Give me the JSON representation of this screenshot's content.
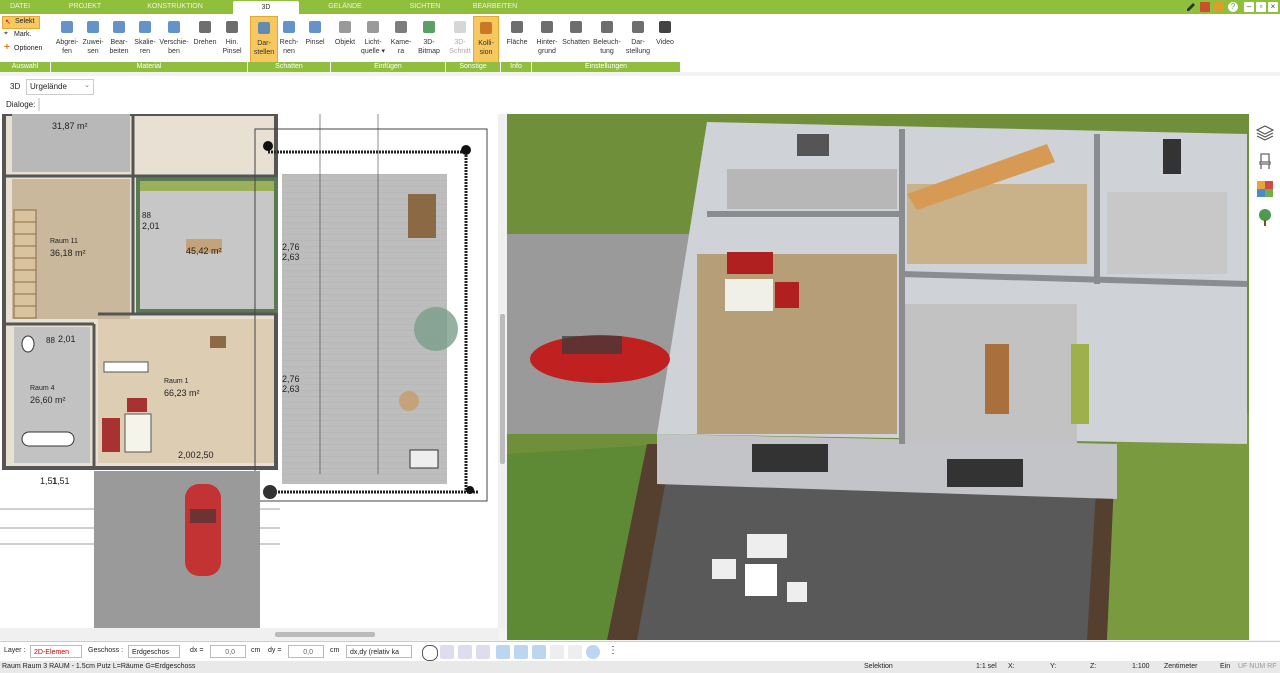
{
  "tabs": [
    {
      "label": "DATEI",
      "active": false
    },
    {
      "label": "PROJEKT",
      "active": false
    },
    {
      "label": "KONSTRUKTION",
      "active": false
    },
    {
      "label": "3D",
      "active": true
    },
    {
      "label": "GELÄNDE",
      "active": false
    },
    {
      "label": "SICHTEN",
      "active": false
    },
    {
      "label": "BEARBEITEN",
      "active": false
    }
  ],
  "ribbon": {
    "auswahl": {
      "selekt": "Selekt",
      "mark": "Mark.",
      "optionen": "Optionen"
    },
    "buttons": [
      {
        "l1": "Abgrei-",
        "l2": "fen",
        "icon": "eyedropper-icon"
      },
      {
        "l1": "Zuwei-",
        "l2": "sen",
        "icon": "paint-bucket-icon"
      },
      {
        "l1": "Bear-",
        "l2": "beiten",
        "icon": "edit-brush-icon"
      },
      {
        "l1": "Skalie-",
        "l2": "ren",
        "icon": "scale-icon"
      },
      {
        "l1": "Verschie-",
        "l2": "ben",
        "icon": "move-icon"
      },
      {
        "l1": "Drehen",
        "l2": "",
        "icon": "rotate-icon"
      },
      {
        "l1": "Hin.",
        "l2": "Pinsel",
        "icon": "brush-icon"
      },
      {
        "l1": "Dar-",
        "l2": "stellen",
        "icon": "cube-render-icon"
      },
      {
        "l1": "Rech-",
        "l2": "nen",
        "icon": "calculate-icon"
      },
      {
        "l1": "Pinsel",
        "l2": "",
        "icon": "pinsel-icon"
      },
      {
        "l1": "Objekt",
        "l2": "",
        "icon": "chair-icon"
      },
      {
        "l1": "Licht-",
        "l2": "quelle ▾",
        "icon": "lightbulb-icon"
      },
      {
        "l1": "Kame-",
        "l2": "ra",
        "icon": "camera-icon"
      },
      {
        "l1": "3D-",
        "l2": "Bitmap",
        "icon": "tree-icon"
      },
      {
        "l1": "3D-",
        "l2": "Schnitt",
        "icon": "section-icon"
      },
      {
        "l1": "Kolli-",
        "l2": "sion",
        "icon": "collision-icon"
      },
      {
        "l1": "Fläche",
        "l2": "",
        "icon": "area-icon"
      },
      {
        "l1": "Hinter-",
        "l2": "grund",
        "icon": "background-icon"
      },
      {
        "l1": "Schatten",
        "l2": "",
        "icon": "shadow-house-icon"
      },
      {
        "l1": "Beleuch-",
        "l2": "tung",
        "icon": "lighting-house-icon"
      },
      {
        "l1": "Dar-",
        "l2": "stellung",
        "icon": "display-icon"
      },
      {
        "l1": "Video",
        "l2": "",
        "icon": "play-icon"
      }
    ],
    "groups": [
      "Auswahl",
      "Material",
      "Schatten",
      "Einfügen",
      "Sonstige",
      "Info",
      "Einstellungen"
    ]
  },
  "optbar": {
    "mode": "3D",
    "terrain": "Urgelände"
  },
  "dlgbar": {
    "label": "Dialoge:"
  },
  "plan": {
    "rooms": [
      {
        "name": "Raum 11",
        "area": "36,18 m²"
      },
      {
        "name": "Raum 4",
        "area": "26,60 m²"
      },
      {
        "name": "Raum 1",
        "area": "66,23 m²"
      }
    ],
    "areas_only": [
      "31,87 m²",
      "45,42 m²"
    ],
    "dims": [
      "88",
      "2,01",
      "88",
      "2,01",
      "2,76",
      "2,63",
      "2,76",
      "2,63",
      "2,00",
      "2,50",
      "1,51",
      "1,51"
    ]
  },
  "statusbar": {
    "layer_label": "Layer :",
    "layer_value": "2D-Elemen",
    "geschoss_label": "Geschoss :",
    "geschoss_value": "Erdgeschos",
    "dx_label": "dx =",
    "dx_value": "0,0",
    "dx_unit": "cm",
    "dy_label": "dy =",
    "dy_value": "0,0",
    "dy_unit": "cm",
    "rel_value": "dx,dy (relativ ka"
  },
  "footer": {
    "info": "Raum Raum 3 RAUM - 1.5cm Putz L=Räume G=Erdgeschoss",
    "mode": "Selektion",
    "sel": "1:1 sel",
    "x": "X:",
    "y": "Y:",
    "z": "Z:",
    "scale": "1:100",
    "unit": "Zentimeter",
    "ein": "Ein",
    "flags": "UF NUM RF"
  },
  "colors": {
    "accent": "#8fbf3c",
    "active_button": "#f6c85f",
    "grass": "#6f8f3b",
    "floor": "#a9b2b8"
  }
}
